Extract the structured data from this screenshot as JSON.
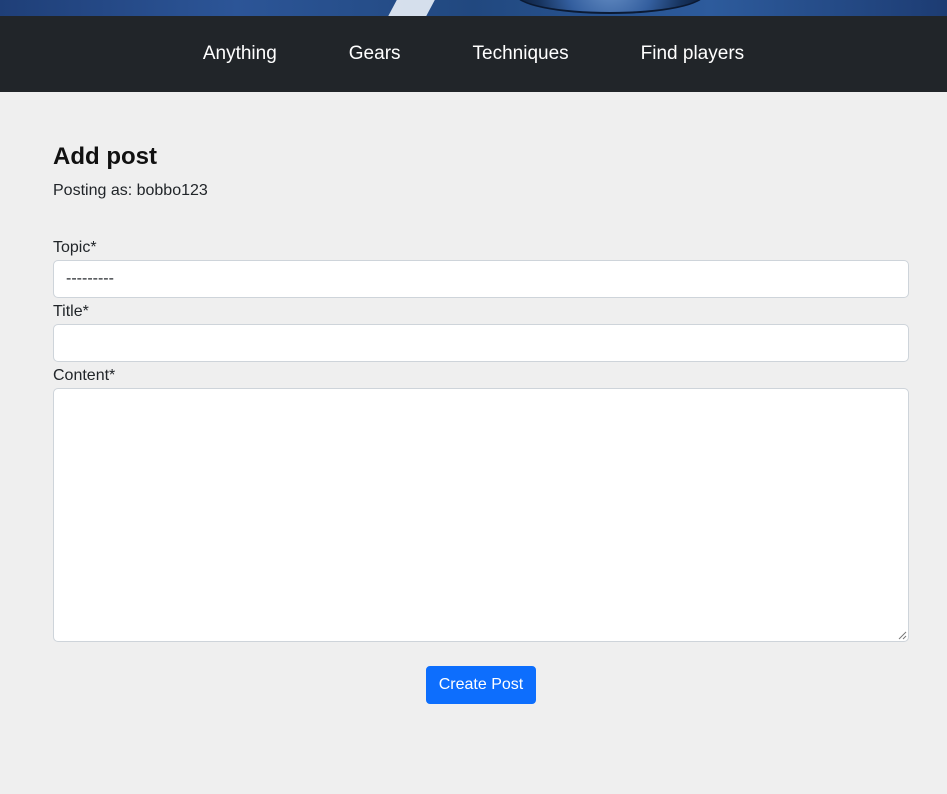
{
  "nav": {
    "items": [
      {
        "label": "Anything"
      },
      {
        "label": "Gears"
      },
      {
        "label": "Techniques"
      },
      {
        "label": "Find players"
      }
    ]
  },
  "page": {
    "title": "Add post",
    "posting_as": "Posting as: bobbo123"
  },
  "form": {
    "topic": {
      "label": "Topic*",
      "selected": "---------"
    },
    "title": {
      "label": "Title*",
      "value": ""
    },
    "content": {
      "label": "Content*",
      "value": ""
    },
    "submit_label": "Create Post"
  },
  "colors": {
    "navbar_bg": "#212529",
    "page_bg": "#efefef",
    "primary": "#0d6efd"
  }
}
